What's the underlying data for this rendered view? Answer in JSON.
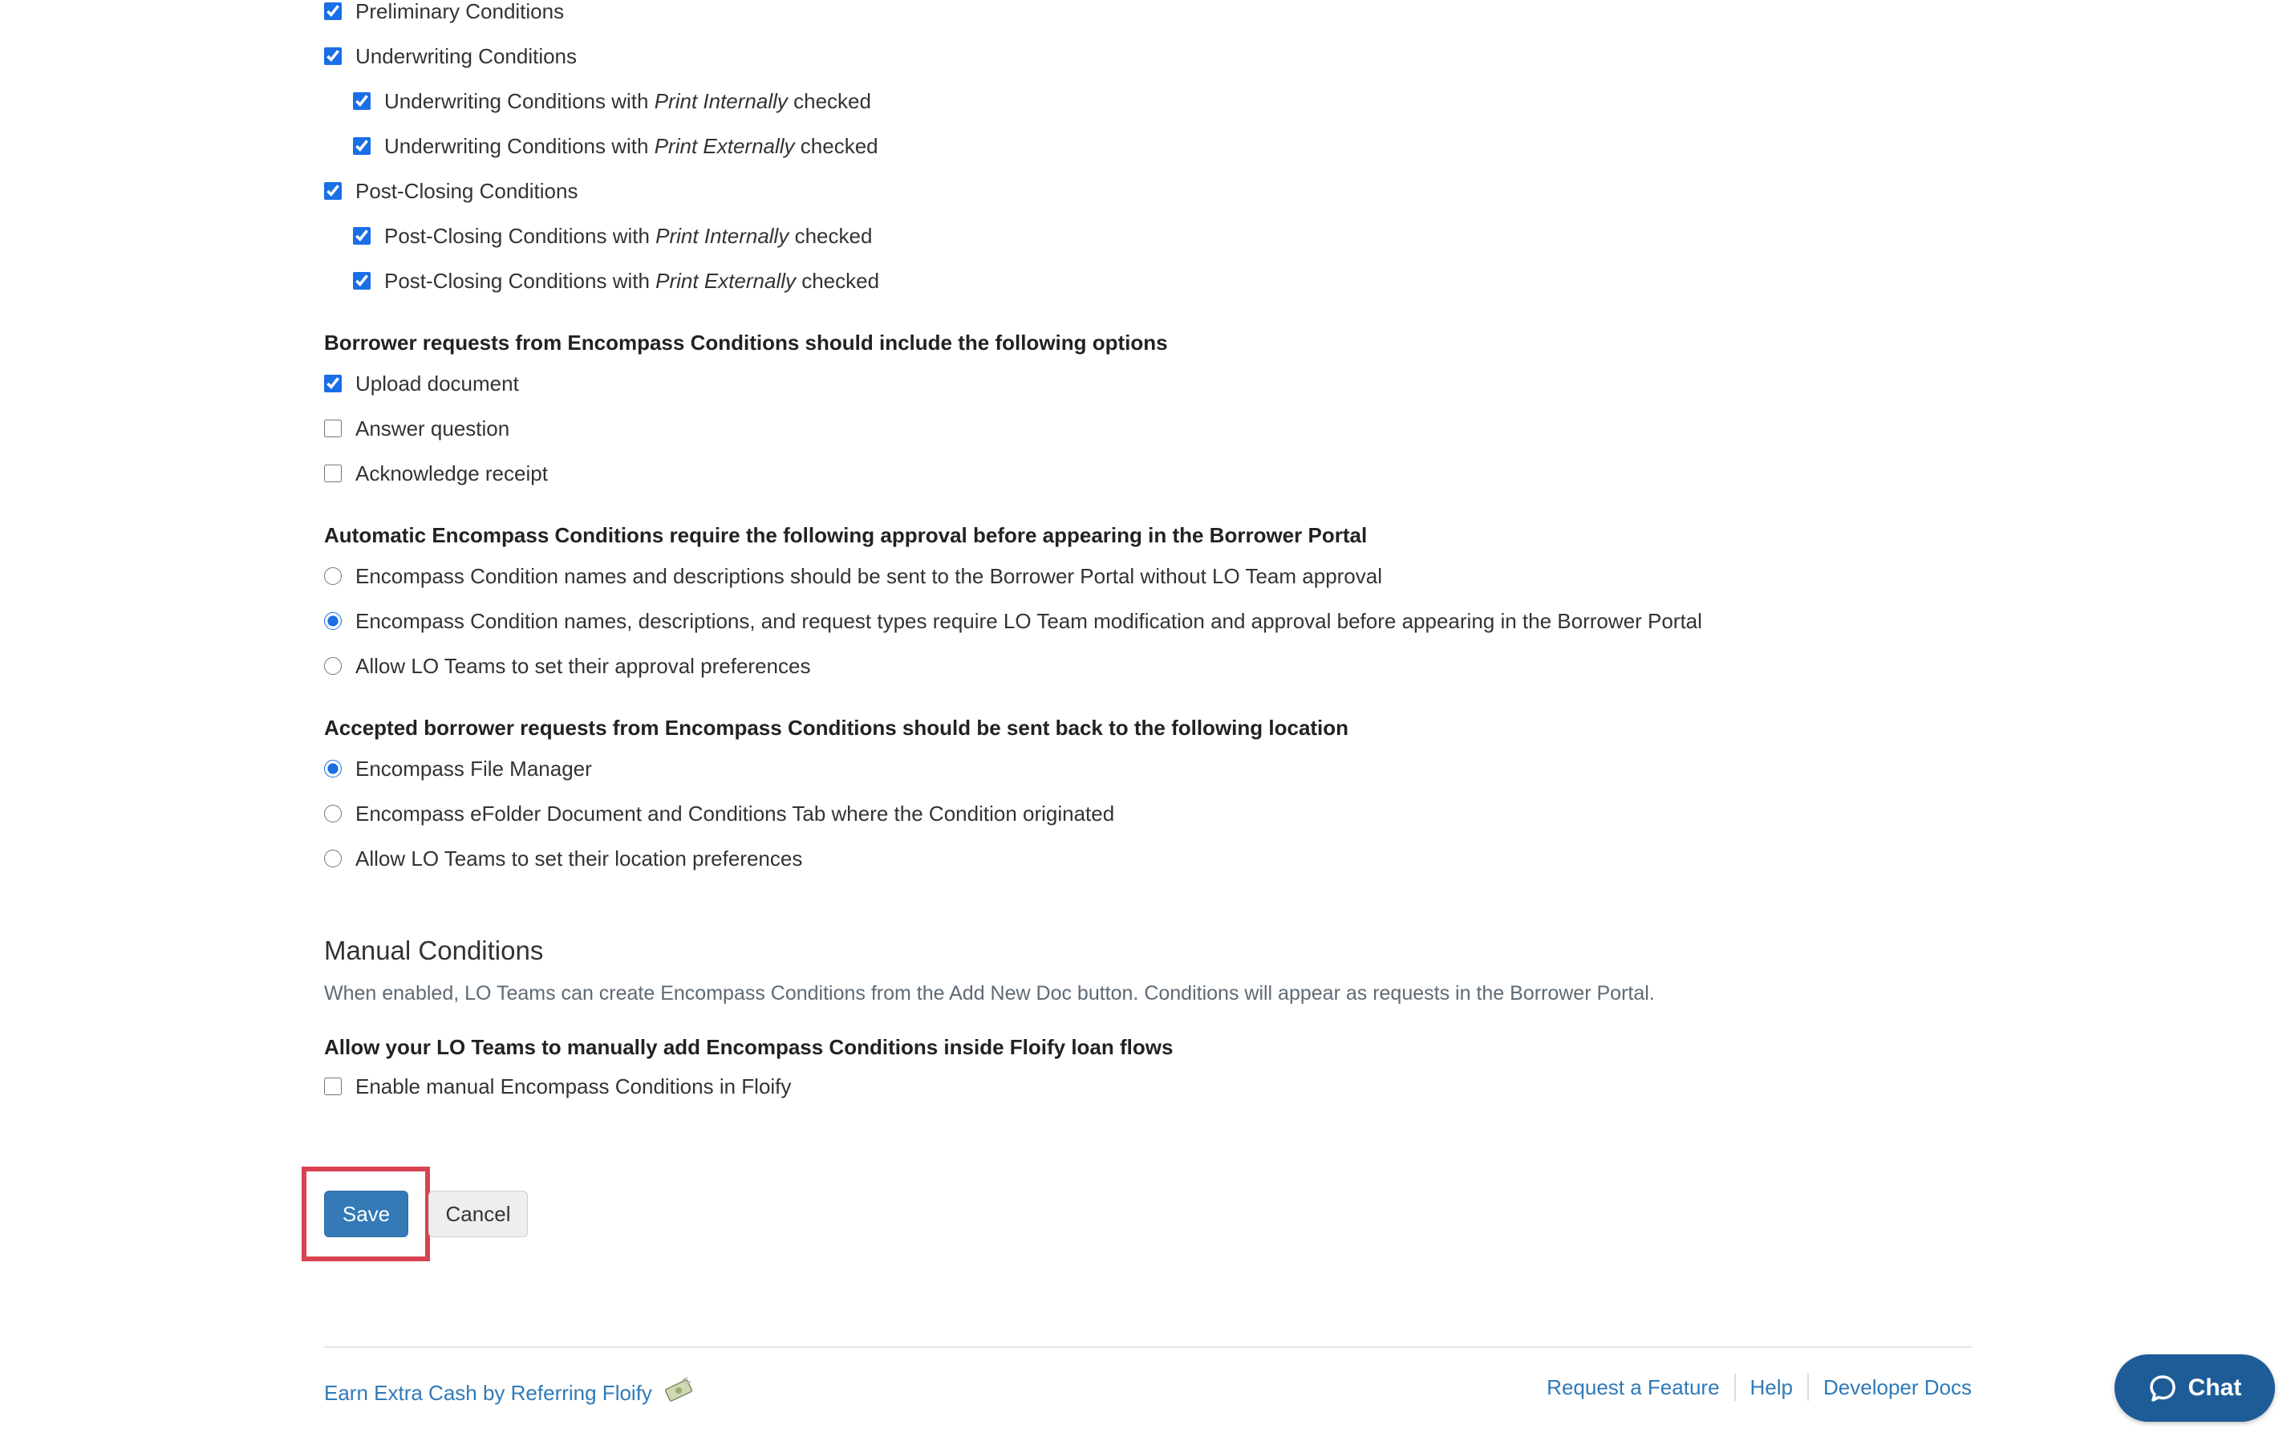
{
  "conditions": {
    "items": [
      {
        "label": "Preliminary Conditions",
        "checked": true
      },
      {
        "label": "Underwriting Conditions",
        "checked": true
      },
      {
        "prefix": "Underwriting Conditions with ",
        "emphasis": "Print Internally",
        "suffix": " checked",
        "checked": true
      },
      {
        "prefix": "Underwriting Conditions with ",
        "emphasis": "Print Externally",
        "suffix": " checked",
        "checked": true
      },
      {
        "label": "Post-Closing Conditions",
        "checked": true
      },
      {
        "prefix": "Post-Closing Conditions with ",
        "emphasis": "Print Internally",
        "suffix": " checked",
        "checked": true
      },
      {
        "prefix": "Post-Closing Conditions with ",
        "emphasis": "Print Externally",
        "suffix": " checked",
        "checked": true
      }
    ]
  },
  "borrower_requests": {
    "heading": "Borrower requests from Encompass Conditions should include the following options",
    "options": [
      {
        "label": "Upload document",
        "checked": true
      },
      {
        "label": "Answer question",
        "checked": false
      },
      {
        "label": "Acknowledge receipt",
        "checked": false
      }
    ]
  },
  "approval": {
    "heading": "Automatic Encompass Conditions require the following approval before appearing in the Borrower Portal",
    "options": [
      {
        "label": "Encompass Condition names and descriptions should be sent to the Borrower Portal without LO Team approval",
        "selected": false
      },
      {
        "label": "Encompass Condition names, descriptions, and request types require LO Team modification and approval before appearing in the Borrower Portal",
        "selected": true
      },
      {
        "label": "Allow LO Teams to set their approval preferences",
        "selected": false
      }
    ]
  },
  "location": {
    "heading": "Accepted borrower requests from Encompass Conditions should be sent back to the following location",
    "options": [
      {
        "label": "Encompass File Manager",
        "selected": true
      },
      {
        "label": "Encompass eFolder Document and Conditions Tab where the Condition originated",
        "selected": false
      },
      {
        "label": "Allow LO Teams to set their location preferences",
        "selected": false
      }
    ]
  },
  "manual": {
    "title": "Manual Conditions",
    "description": "When enabled, LO Teams can create Encompass Conditions from the Add New Doc button. Conditions will appear as requests in the Borrower Portal.",
    "heading": "Allow your LO Teams to manually add Encompass Conditions inside Floify loan flows",
    "option": {
      "label": "Enable manual Encompass Conditions in Floify",
      "checked": false
    }
  },
  "actions": {
    "save_label": "Save",
    "cancel_label": "Cancel"
  },
  "footer": {
    "referral": "Earn Extra Cash by Referring Floify",
    "links": [
      "Request a Feature",
      "Help",
      "Developer Docs"
    ]
  },
  "chat": {
    "label": "Chat"
  },
  "colors": {
    "accent": "#337ab7",
    "link": "#2f7ab8",
    "highlight": "#d94350",
    "chat": "#1d5c97"
  }
}
